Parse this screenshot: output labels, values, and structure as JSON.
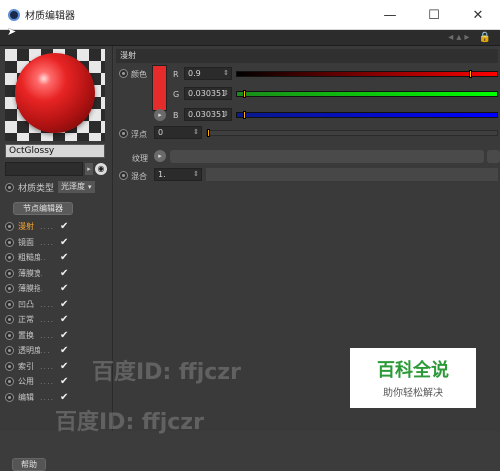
{
  "window": {
    "title": "材质编辑器",
    "minimize_glyph": "—",
    "maximize_glyph": "☐",
    "close_glyph": "✕"
  },
  "left_panel": {
    "material_name": "OctGlossy",
    "material_type_label": "材质类型",
    "material_type_value": "光泽度",
    "node_editor_button": "节点编辑器",
    "channels": [
      {
        "label": "漫射",
        "dots": "....",
        "checked": "✔",
        "active": true
      },
      {
        "label": "镜面",
        "dots": "....",
        "checked": "✔",
        "active": false
      },
      {
        "label": "粗糙度",
        "dots": "..",
        "checked": "✔",
        "active": false
      },
      {
        "label": "薄膜宽度",
        "dots": ".",
        "checked": "✔",
        "active": false
      },
      {
        "label": "薄膜指数",
        "dots": ".",
        "checked": "✔",
        "active": false
      },
      {
        "label": "凹凸",
        "dots": "....",
        "checked": "✔",
        "active": false
      },
      {
        "label": "正常",
        "dots": "....",
        "checked": "✔",
        "active": false
      },
      {
        "label": "置换",
        "dots": "....",
        "checked": "✔",
        "active": false
      },
      {
        "label": "透明度",
        "dots": "...",
        "checked": "✔",
        "active": false
      },
      {
        "label": "索引",
        "dots": "....",
        "checked": "✔",
        "active": false
      },
      {
        "label": "公用",
        "dots": "....",
        "checked": "✔",
        "active": false
      },
      {
        "label": "编辑",
        "dots": "....",
        "checked": "✔",
        "active": false
      }
    ],
    "help_button": "帮助"
  },
  "right_panel": {
    "section_title": "漫射",
    "color_label": "颜色",
    "color_swatch": "#e62b2b",
    "r_label": "R",
    "r_value": "0.9",
    "r_level": 0.9,
    "g_label": "G",
    "g_value": "0.030351",
    "g_level": 0.030351,
    "b_label": "B",
    "b_value": "0.030351",
    "b_level": 0.030351,
    "float_label": "浮点",
    "float_value": "0",
    "texture_label": "纹理",
    "mix_label": "混合",
    "mix_value": "1."
  },
  "watermarks": {
    "baidu_id_1": "百度ID: ffjczr",
    "baidu_id_2": "百度ID: ffjczr"
  },
  "logo": {
    "main": "百科全说",
    "sub": "助你轻松解决"
  },
  "colors": {
    "accent_active": "#f0a030",
    "slider_knob": "#ffb000"
  }
}
